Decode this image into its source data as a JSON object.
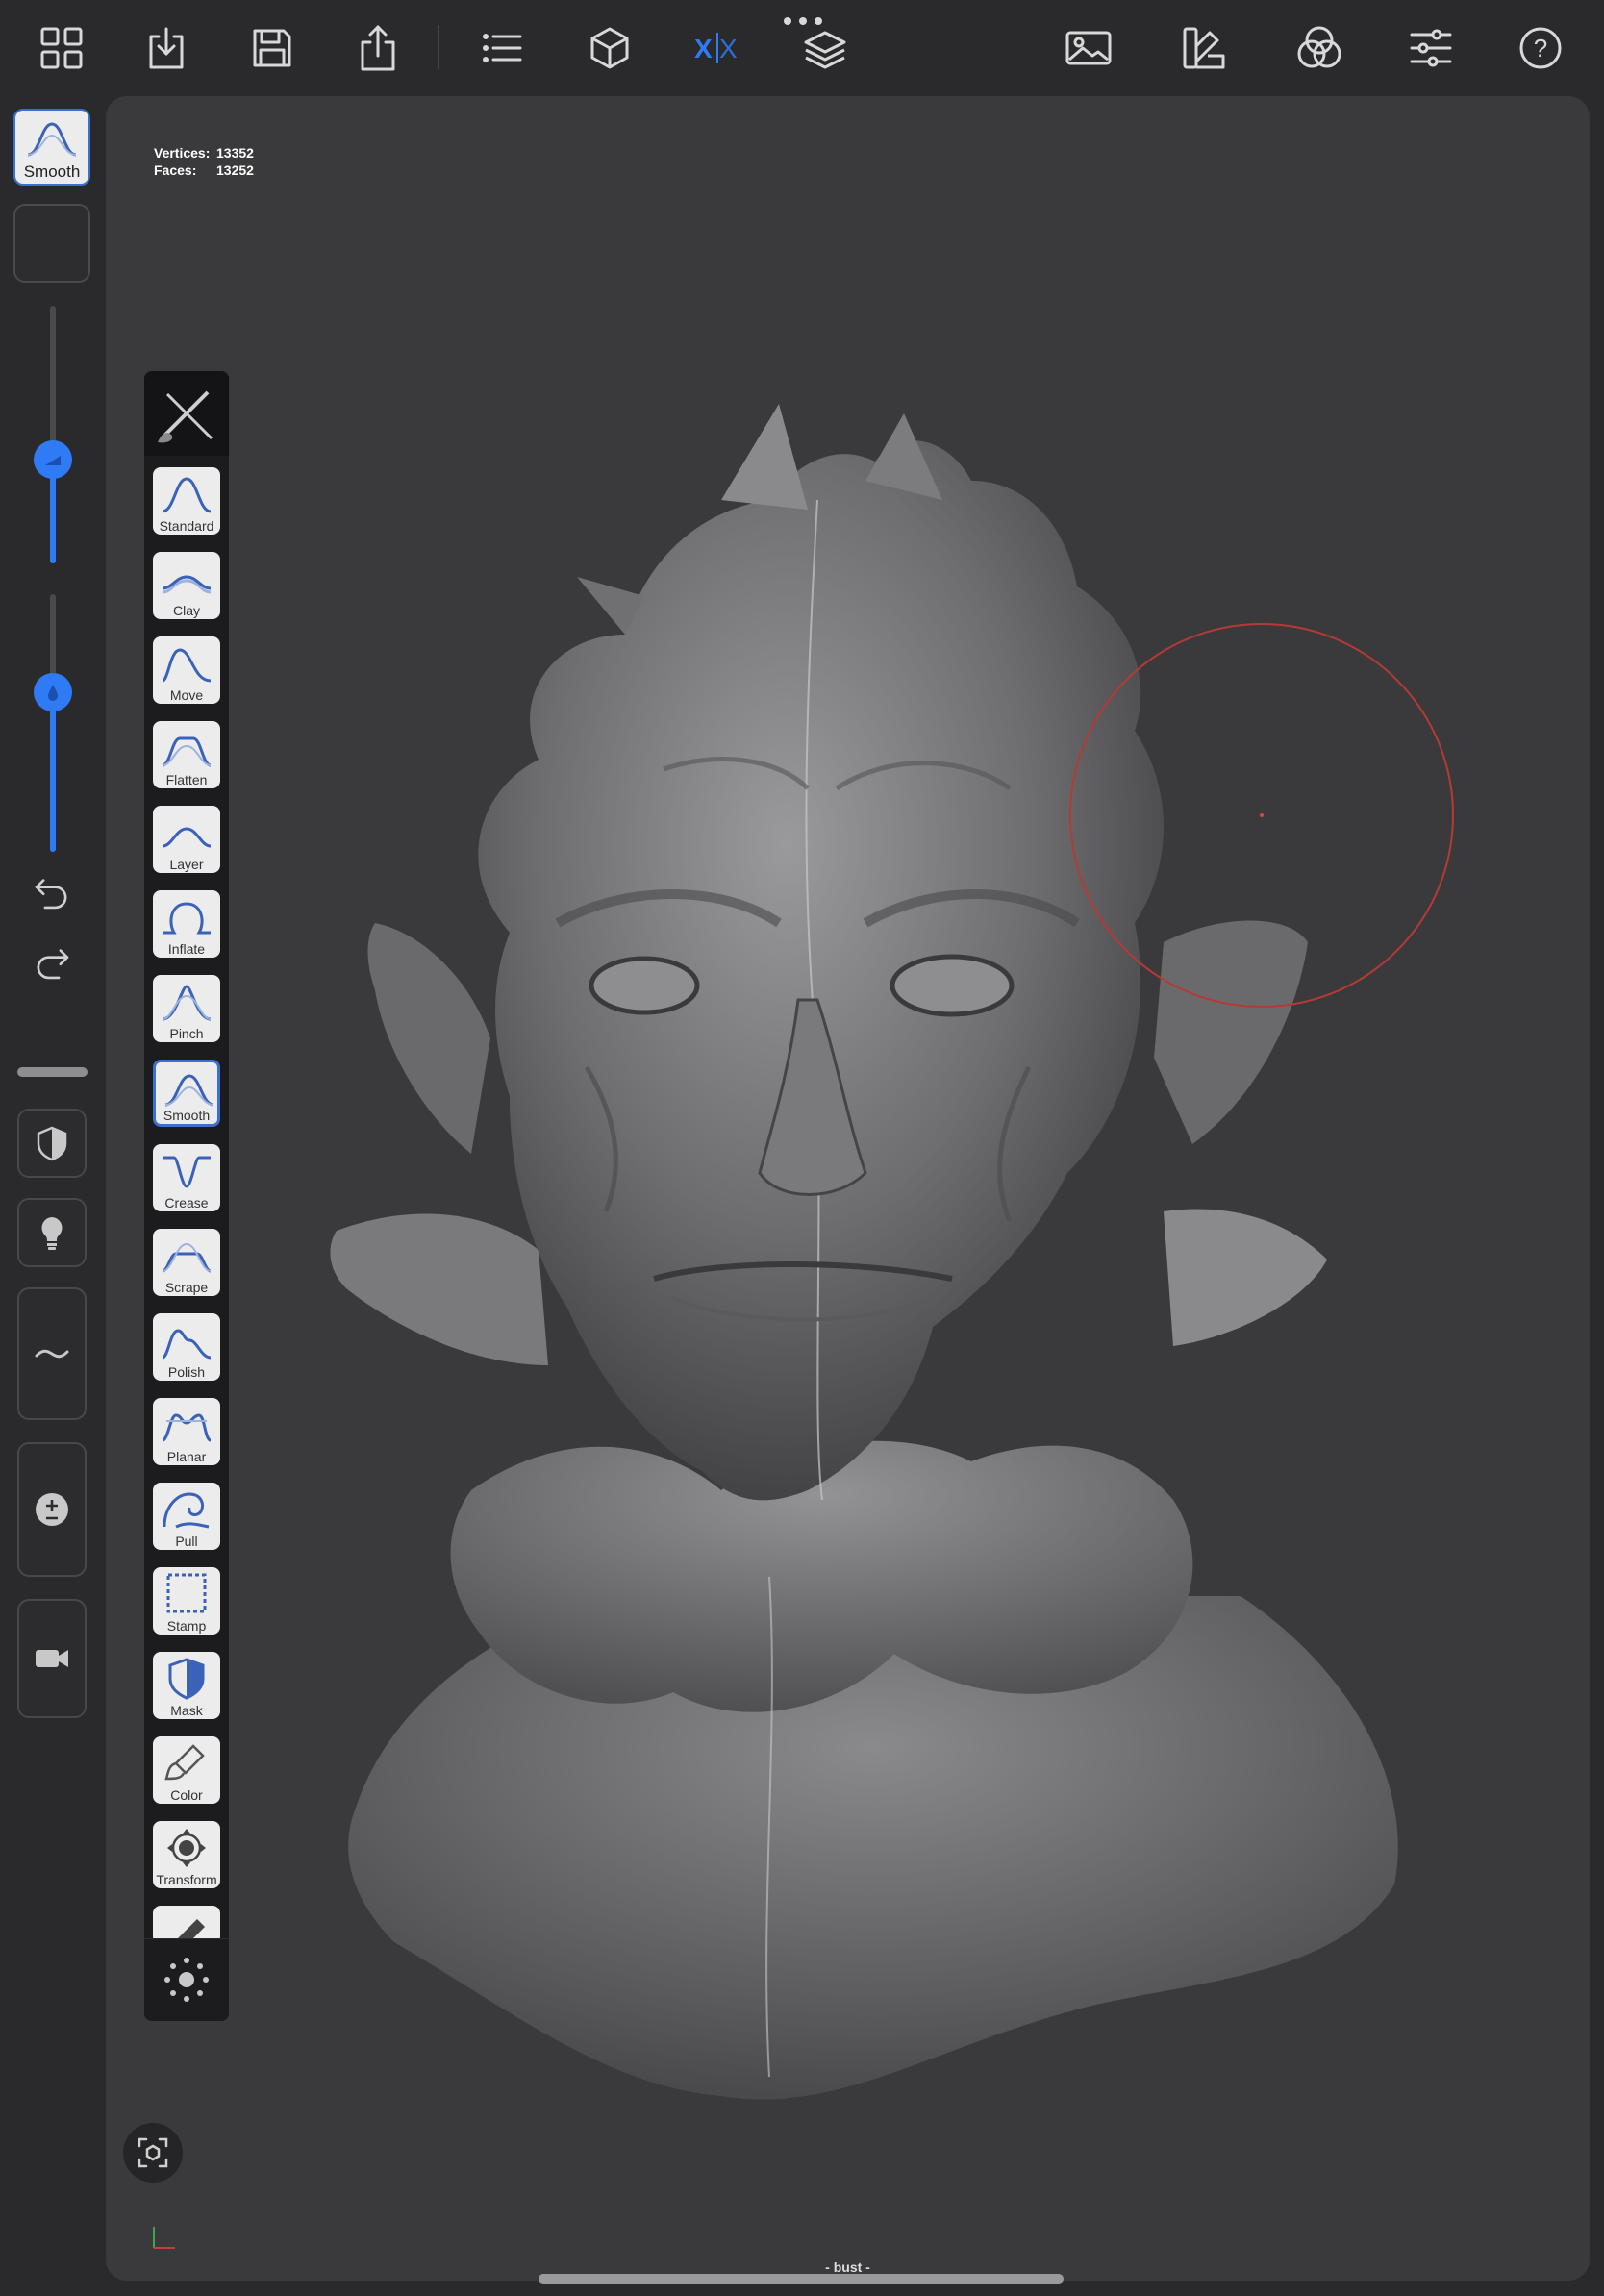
{
  "toolbar": {
    "icons": [
      "grid-icon",
      "import-icon",
      "save-icon",
      "share-icon",
      "list-icon",
      "cube-icon",
      "symmetry-icon",
      "layers-icon",
      "image-icon",
      "palette-icon",
      "material-icon",
      "sliders-icon",
      "help-icon"
    ],
    "symmetry_label": "X|X",
    "accent": "#2f7bf6"
  },
  "left_column": {
    "primary_tool_label": "Smooth",
    "radius_slider_value": 0.42,
    "intensity_slider_value": 0.6,
    "icons": [
      "undo-icon",
      "redo-icon",
      "mask-icon",
      "light-icon",
      "stroke-icon",
      "plus-minus-icon",
      "camera-icon"
    ]
  },
  "viewport": {
    "stats": {
      "vertices_label": "Vertices:",
      "vertices_value": "13352",
      "faces_label": "Faces:",
      "faces_value": "13252"
    },
    "mesh_name": "- bust -",
    "cursor_color": "#b53a34"
  },
  "palette": {
    "tools": [
      {
        "label": "Standard",
        "icon": "standard"
      },
      {
        "label": "Clay",
        "icon": "clay"
      },
      {
        "label": "Move",
        "icon": "move"
      },
      {
        "label": "Flatten",
        "icon": "flatten"
      },
      {
        "label": "Layer",
        "icon": "layer"
      },
      {
        "label": "Inflate",
        "icon": "inflate"
      },
      {
        "label": "Pinch",
        "icon": "pinch"
      },
      {
        "label": "Smooth",
        "icon": "smooth",
        "active": true
      },
      {
        "label": "Crease",
        "icon": "crease"
      },
      {
        "label": "Scrape",
        "icon": "scrape"
      },
      {
        "label": "Polish",
        "icon": "polish"
      },
      {
        "label": "Planar",
        "icon": "planar"
      },
      {
        "label": "Pull",
        "icon": "pull"
      },
      {
        "label": "Stamp",
        "icon": "stamp"
      },
      {
        "label": "Mask",
        "icon": "mask"
      },
      {
        "label": "Color",
        "icon": "color"
      },
      {
        "label": "Transform",
        "icon": "transform"
      }
    ]
  }
}
